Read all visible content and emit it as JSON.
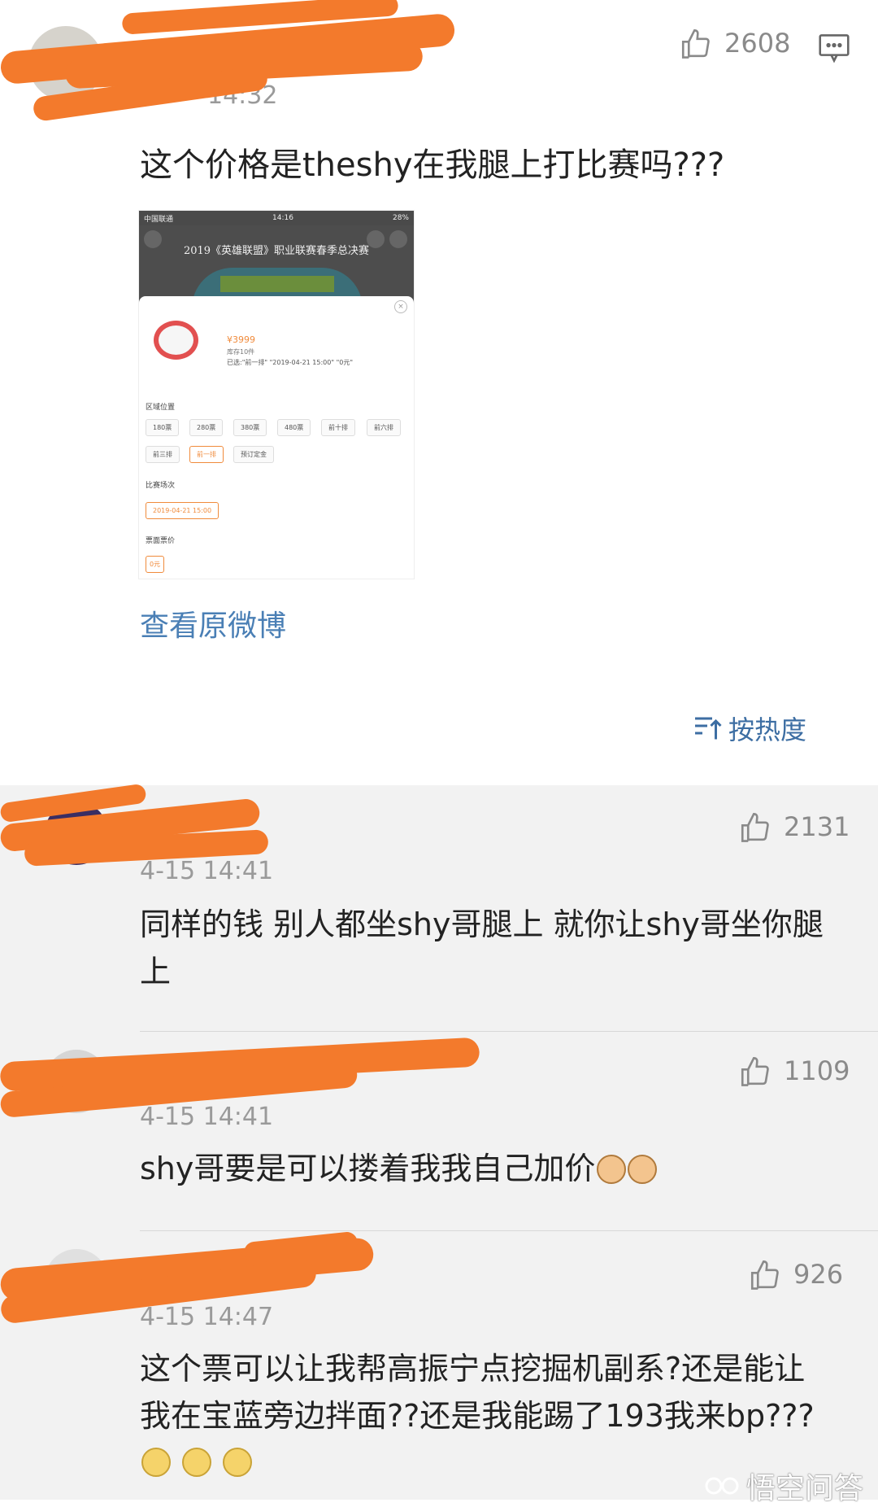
{
  "main_post": {
    "timestamp": "14:32",
    "likes": "2608",
    "text": "这个价格是theshy在我腿上打比赛吗???",
    "view_original": "查看原微博",
    "embedded_screenshot": {
      "status_carrier": "中国联通",
      "status_time": "14:16",
      "status_battery": "28%",
      "banner_title": "2019《英雄联盟》职业联赛春季总决赛",
      "price": "¥3999",
      "stock": "库存10件",
      "selected": "已选:\"前一排\" \"2019-04-21 15:00\" \"0元\"",
      "section_area": "区域位置",
      "area_chips": [
        "180票",
        "280票",
        "380票",
        "480票",
        "前十排",
        "前六排",
        "前三排",
        "前一排",
        "预订定金"
      ],
      "section_session": "比赛场次",
      "session_chip": "2019-04-21 15:00",
      "section_price": "票面票价",
      "price_chip": "0元"
    }
  },
  "sort_label": "按热度",
  "comments": [
    {
      "likes": "2131",
      "time": "4-15 14:41",
      "lines": [
        "同样的钱 别人都坐shy哥腿上 就你让shy哥坐你腿",
        "上"
      ]
    },
    {
      "likes": "1109",
      "time": "4-15 14:41",
      "lines": [
        "shy哥要是可以搂着我我自己加价"
      ]
    },
    {
      "likes": "926",
      "time": "4-15 14:47",
      "lines": [
        "这个票可以让我帮高振宁点挖掘机副系?还是能让",
        "我在宝蓝旁边拌面??还是我能踢了193我来bp???"
      ]
    }
  ],
  "watermark": "悟空问答",
  "colors": {
    "redaction": "#f37a2c",
    "link": "#4a7fb5",
    "comment_bg": "#f2f2f2"
  },
  "icons": [
    "thumbs-up-icon",
    "comment-icon",
    "sort-icon",
    "wukong-logo-icon"
  ]
}
